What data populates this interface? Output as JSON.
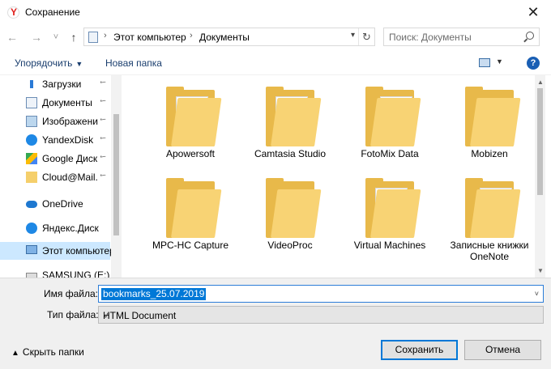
{
  "window": {
    "title": "Сохранение",
    "close_glyph": "✕"
  },
  "nav": {
    "back_glyph": "←",
    "forward_glyph": "→",
    "recent_glyph": "˅",
    "up_glyph": "↑",
    "breadcrumb": [
      "Этот компьютер",
      "Документы"
    ],
    "crumb_sep": "›",
    "refresh_glyph": "↻",
    "search_placeholder": "Поиск: Документы"
  },
  "commands": {
    "organize": "Упорядочить",
    "new_folder": "Новая папка",
    "help": "?"
  },
  "sidebar": {
    "items": [
      {
        "label": "Загрузки",
        "icon": "download-icon",
        "pinned": true
      },
      {
        "label": "Документы",
        "icon": "document-icon",
        "pinned": true
      },
      {
        "label": "Изображени",
        "icon": "pictures-icon",
        "pinned": true
      },
      {
        "label": "YandexDisk",
        "icon": "yandex-disk-icon",
        "pinned": true
      },
      {
        "label": "Google Диск",
        "icon": "google-drive-icon",
        "pinned": true
      },
      {
        "label": "Cloud@Mail.",
        "icon": "folder-icon",
        "pinned": true
      },
      {
        "label": "OneDrive",
        "icon": "onedrive-icon",
        "pinned": false
      },
      {
        "label": "Яндекс.Диск",
        "icon": "yandex-disk-icon",
        "pinned": false
      },
      {
        "label": "Этот компьютер",
        "icon": "computer-icon",
        "pinned": false,
        "selected": true
      },
      {
        "label": "SAMSUNG (E:)",
        "icon": "drive-icon",
        "pinned": false
      }
    ],
    "pin_glyph": "📌"
  },
  "folders": [
    {
      "label": "Apowersoft",
      "style": "docs"
    },
    {
      "label": "Camtasia Studio",
      "style": "docs"
    },
    {
      "label": "FotoMix Data",
      "style": "blank"
    },
    {
      "label": "Mobizen",
      "style": "plain"
    },
    {
      "label": "MPC-HC Capture",
      "style": "plain"
    },
    {
      "label": "VideoProc",
      "style": "plain"
    },
    {
      "label": "Virtual Machines",
      "style": "docs"
    },
    {
      "label": "Записные книжки OneNote",
      "style": "blank"
    }
  ],
  "form": {
    "filename_label": "Имя файла:",
    "filename_value": "bookmarks_25.07.2019",
    "filetype_label": "Тип файла:",
    "filetype_value": "HTML Document",
    "hide_folders": "Скрыть папки",
    "save": "Сохранить",
    "cancel": "Отмена"
  },
  "colors": {
    "accent": "#0078d7",
    "folder": "#f8d374",
    "selection": "#cce8ff"
  }
}
